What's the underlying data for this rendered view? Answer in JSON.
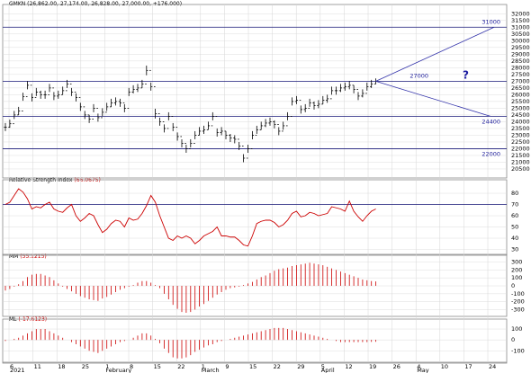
{
  "colors": {
    "background": "#ffffff",
    "frame": "#8a8a8a",
    "grid": "#d6d6d6",
    "price_bar": "#000000",
    "hline": "#1a1a7a",
    "trend": "#3333aa",
    "rsi_line": "#cc0000",
    "histogram": "#cc0000",
    "annotation": "#1a1a99"
  },
  "chart_data": [
    {
      "type": "ohlc",
      "panel": "price",
      "title": "GMKN (26,862.00, 27,174.00, 26,828.00, 27,000.00, +176.000)",
      "title_parts": {
        "symbol": "GMKN",
        "values": "(26,862.00, 27,174.00, 26,828.00, 27,000.00, +176.000)"
      },
      "y_ticks": [
        20500,
        21000,
        21500,
        22000,
        22500,
        23000,
        23500,
        24000,
        24500,
        25000,
        25500,
        26000,
        26500,
        27000,
        27500,
        28000,
        28500,
        29000,
        29500,
        30000,
        30500,
        31000,
        31500,
        32000
      ],
      "ylim": [
        20100,
        32350
      ],
      "x_categories": [
        "6",
        "11",
        "18",
        "25",
        "1",
        "8",
        "15",
        "22",
        "1",
        "9",
        "15",
        "22",
        "29",
        "5",
        "12",
        "19",
        "26",
        "4",
        "10",
        "17",
        "24"
      ],
      "month_labels": [
        {
          "label": "2021",
          "at": 0
        },
        {
          "label": "February",
          "at": 4
        },
        {
          "label": "March",
          "at": 8
        },
        {
          "label": "April",
          "at": 13
        },
        {
          "label": "May",
          "at": 17
        }
      ],
      "grid": true,
      "close": [
        23600,
        23850,
        24500,
        24800,
        25850,
        26700,
        25800,
        26200,
        26000,
        26000,
        26500,
        25900,
        26000,
        26300,
        26800,
        26200,
        25800,
        25100,
        24500,
        24200,
        25000,
        24300,
        24700,
        25100,
        25400,
        25500,
        25400,
        25000,
        26200,
        26400,
        26500,
        26800,
        27800,
        26600,
        24600,
        24000,
        23500,
        24400,
        23600,
        22900,
        22400,
        22000,
        22400,
        23000,
        23300,
        23400,
        23700,
        24400,
        23200,
        23300,
        23000,
        22800,
        22700,
        22200,
        21300,
        22000,
        23000,
        23400,
        23700,
        23900,
        24000,
        23800,
        23300,
        23700,
        24400,
        25500,
        25600,
        24900,
        25000,
        25400,
        25200,
        25300,
        25600,
        25700,
        26300,
        26300,
        26500,
        26600,
        26700,
        26400,
        25900,
        26100,
        26600,
        26800,
        27000
      ],
      "bar_range": [
        500,
        500,
        500,
        500,
        500,
        500,
        500,
        500,
        500,
        500,
        500,
        500,
        500,
        500,
        500,
        500,
        500,
        500,
        500,
        500,
        500,
        500,
        500,
        500,
        500,
        500,
        500,
        500,
        500,
        500,
        500,
        500,
        600,
        500,
        600,
        500,
        500,
        500,
        500,
        500,
        500,
        500,
        500,
        500,
        500,
        500,
        500,
        500,
        500,
        500,
        500,
        500,
        500,
        500,
        500,
        500,
        500,
        500,
        500,
        500,
        500,
        500,
        500,
        500,
        500,
        500,
        500,
        500,
        500,
        500,
        500,
        500,
        500,
        500,
        500,
        500,
        500,
        500,
        500,
        500,
        500,
        500,
        500,
        500,
        346
      ],
      "horizontal_levels": [
        31000,
        27000,
        24400,
        22000
      ],
      "annotations": [
        {
          "text": "31000",
          "value": 31000
        },
        {
          "text": "27000",
          "value": 27000
        },
        {
          "text": "24400",
          "value": 24400
        },
        {
          "text": "22000",
          "value": 22000
        },
        {
          "text": "?",
          "value": 27000
        }
      ],
      "projection": {
        "from_value": 27000,
        "up_to": 31000,
        "down_to": 24400
      }
    },
    {
      "type": "line",
      "panel": "rsi",
      "title": "Relative Strength Index (66.0675)",
      "title_parts": {
        "name": "Relative Strength Index",
        "value": "(66.0675)"
      },
      "y_ticks": [
        30,
        40,
        50,
        60,
        70,
        80
      ],
      "ylim": [
        28,
        88
      ],
      "level": 70,
      "values": [
        70,
        72,
        78,
        84,
        81,
        75,
        66,
        68,
        67,
        70,
        72,
        66,
        64,
        63,
        67,
        70,
        60,
        55,
        58,
        62,
        60,
        52,
        45,
        48,
        53,
        56,
        55,
        50,
        58,
        56,
        57,
        62,
        69,
        78,
        72,
        60,
        50,
        40,
        38,
        42,
        40,
        42,
        40,
        35,
        38,
        42,
        44,
        46,
        50,
        42,
        42,
        41,
        41,
        38,
        34,
        33,
        42,
        53,
        55,
        56,
        56,
        54,
        50,
        52,
        56,
        62,
        64,
        59,
        60,
        63,
        62,
        60,
        61,
        62,
        68,
        67,
        66,
        64,
        73,
        64,
        59,
        55,
        60,
        64,
        66
      ]
    },
    {
      "type": "histogram",
      "panel": "mm",
      "title": "MM (55.1215)",
      "title_parts": {
        "name": "MM",
        "value": "(55.1215)"
      },
      "y_ticks": [
        -300,
        -200,
        -100,
        0,
        100,
        200,
        300
      ],
      "ylim": [
        -340,
        340
      ],
      "values": [
        -60,
        -40,
        -10,
        20,
        60,
        110,
        140,
        150,
        150,
        130,
        110,
        70,
        30,
        -10,
        -40,
        -70,
        -100,
        -130,
        -150,
        -170,
        -180,
        -190,
        -160,
        -140,
        -110,
        -80,
        -50,
        -30,
        -10,
        10,
        40,
        60,
        60,
        40,
        10,
        -30,
        -100,
        -170,
        -240,
        -290,
        -330,
        -340,
        -330,
        -300,
        -260,
        -230,
        -190,
        -150,
        -110,
        -80,
        -50,
        -30,
        -20,
        -10,
        10,
        30,
        50,
        80,
        110,
        130,
        160,
        190,
        210,
        220,
        230,
        250,
        260,
        270,
        280,
        290,
        280,
        270,
        260,
        240,
        220,
        200,
        180,
        160,
        140,
        120,
        100,
        80,
        70,
        60,
        55
      ]
    },
    {
      "type": "histogram",
      "panel": "ml",
      "title": "ML (-17.6123)",
      "title_parts": {
        "name": "ML",
        "value": "(-17.6123)"
      },
      "y_ticks": [
        -100,
        0,
        100
      ],
      "ylim": [
        -180,
        150
      ],
      "values": [
        -10,
        0,
        10,
        20,
        40,
        60,
        80,
        100,
        100,
        100,
        80,
        60,
        40,
        20,
        0,
        -20,
        -40,
        -60,
        -80,
        -100,
        -110,
        -120,
        -100,
        -80,
        -60,
        -40,
        -20,
        -10,
        0,
        20,
        40,
        60,
        60,
        40,
        10,
        -30,
        -80,
        -120,
        -160,
        -170,
        -170,
        -160,
        -140,
        -110,
        -90,
        -70,
        -50,
        -40,
        -20,
        -10,
        0,
        10,
        20,
        30,
        40,
        50,
        60,
        70,
        80,
        90,
        100,
        110,
        110,
        110,
        100,
        90,
        80,
        70,
        60,
        50,
        40,
        30,
        20,
        10,
        0,
        -10,
        -20,
        -20,
        -20,
        -20,
        -20,
        -20,
        -20,
        -18,
        -17
      ]
    }
  ]
}
